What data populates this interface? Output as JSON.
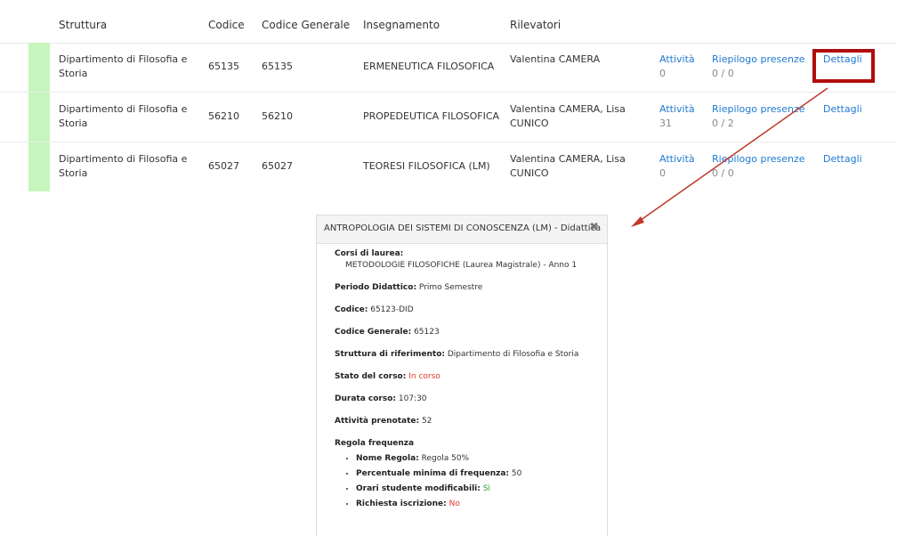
{
  "table": {
    "headers": {
      "struttura": "Struttura",
      "codice": "Codice",
      "codice_generale": "Codice Generale",
      "insegnamento": "Insegnamento",
      "rilevatori": "Rilevatori"
    },
    "rows": [
      {
        "struttura": "Dipartimento di Filosofia e Storia",
        "codice": "65135",
        "codice_generale": "65135",
        "insegnamento": "ERMENEUTICA FILOSOFICA",
        "rilevatori": "Valentina CAMERA",
        "attivita_label": "Attività",
        "attivita_count": "0",
        "riepilogo_label": "Riepilogo presenze",
        "riepilogo_value": "0 / 0",
        "dettagli_label": "Dettagli"
      },
      {
        "struttura": "Dipartimento di Filosofia e Storia",
        "codice": "56210",
        "codice_generale": "56210",
        "insegnamento": "PROPEDEUTICA FILOSOFICA",
        "rilevatori": "Valentina CAMERA, Lisa CUNICO",
        "attivita_label": "Attività",
        "attivita_count": "31",
        "riepilogo_label": "Riepilogo presenze",
        "riepilogo_value": "0 / 2",
        "dettagli_label": "Dettagli"
      },
      {
        "struttura": "Dipartimento di Filosofia e Storia",
        "codice": "65027",
        "codice_generale": "65027",
        "insegnamento": "TEORESI FILOSOFICA (LM)",
        "rilevatori": "Valentina CAMERA, Lisa CUNICO",
        "attivita_label": "Attività",
        "attivita_count": "0",
        "riepilogo_label": "Riepilogo presenze",
        "riepilogo_value": "0 / 0",
        "dettagli_label": "Dettagli"
      }
    ]
  },
  "panel": {
    "title": "ANTROPOLOGIA DEI SISTEMI DI CONOSCENZA (LM) - Didattica",
    "close_icon": "close-icon",
    "corsi_label": "Corsi di laurea:",
    "corsi_value": "METODOLOGIE FILOSOFICHE (Laurea Magistrale) - Anno 1",
    "periodo_label": "Periodo Didattico:",
    "periodo_value": "Primo Semestre",
    "codice_label": "Codice:",
    "codice_value": "65123-DID",
    "codice_generale_label": "Codice Generale:",
    "codice_generale_value": "65123",
    "struttura_label": "Struttura di riferimento:",
    "struttura_value": "Dipartimento di Filosofia e Storia",
    "stato_label": "Stato del corso:",
    "stato_value": "In corso",
    "durata_label": "Durata corso:",
    "durata_value": "107:30",
    "attivita_label": "Attività prenotate:",
    "attivita_value": "52",
    "regola_label": "Regola frequenza",
    "regola_items": [
      {
        "label": "Nome Regola:",
        "value": "Regola 50%"
      },
      {
        "label": "Percentuale minima di frequenza:",
        "value": "50"
      },
      {
        "label": "Orari studente modificabili:",
        "value": "Sì"
      },
      {
        "label": "Richiesta iscrizione:",
        "value": "No"
      }
    ]
  },
  "colors": {
    "link": "#1e7ad1",
    "status_green": "#c6f5bd",
    "highlight_red": "#b00d0d",
    "value_red": "#e0392a",
    "value_green": "#2f9b3a"
  }
}
